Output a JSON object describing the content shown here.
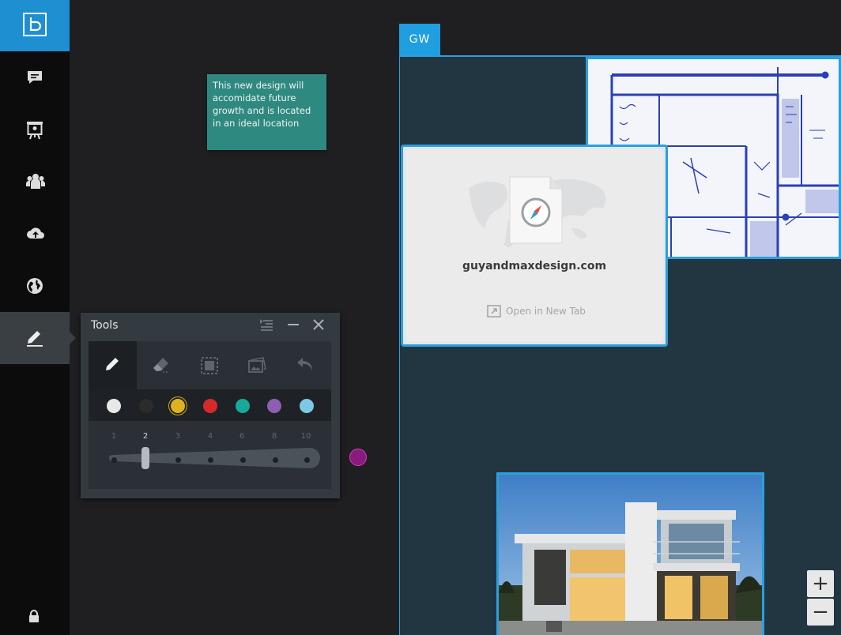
{
  "sidebar": {
    "items": [
      {
        "icon": "chat-icon"
      },
      {
        "icon": "presentation-icon"
      },
      {
        "icon": "people-icon"
      },
      {
        "icon": "cloud-upload-icon"
      },
      {
        "icon": "globe-icon"
      },
      {
        "icon": "pen-icon",
        "active": true
      }
    ],
    "lock_icon": "lock-icon"
  },
  "note": {
    "text": "This new design will accomidate future growth and is located in an ideal location",
    "color": "#2e8a80"
  },
  "tools": {
    "title": "Tools",
    "tool_icons": [
      "pen-icon",
      "eraser-icon",
      "select-icon",
      "image-icon",
      "undo-icon"
    ],
    "colors": [
      "#e8e8e8",
      "#2b2b2b",
      "#e0b020",
      "#d62a2a",
      "#17a99a",
      "#8d5fb3",
      "#7cc8e6"
    ],
    "selected_color": "#e0b020",
    "sizes": [
      "1",
      "2",
      "3",
      "4",
      "6",
      "8",
      "10"
    ],
    "selected_size": "2"
  },
  "workspace": {
    "tab_label": "GW",
    "accent": "#2aa0df",
    "web_card": {
      "domain": "guyandmaxdesign.com",
      "open_label": "Open in New Tab"
    }
  },
  "zoom": {
    "in": "+",
    "out": "−"
  }
}
